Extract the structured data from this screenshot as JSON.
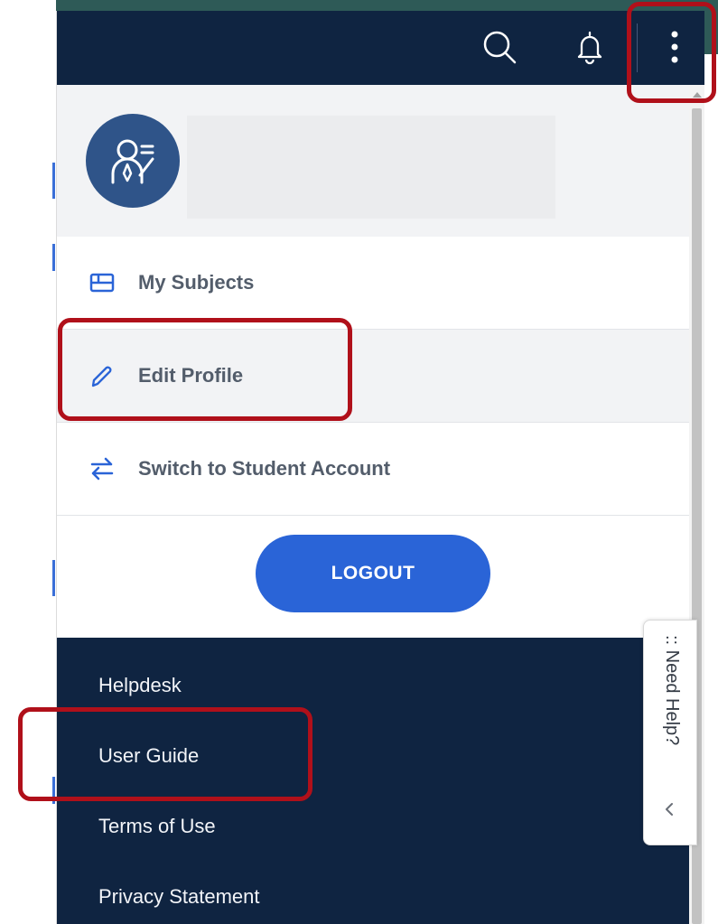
{
  "colors": {
    "topbar": "#0f2441",
    "accent": "#2a64d7",
    "avatar_bg": "#2f5489",
    "menu_text": "#535d6b",
    "highlight": "#b0101a"
  },
  "topbar": {
    "icons": [
      "search-icon",
      "bell-icon",
      "more-vertical-icon"
    ]
  },
  "profile": {
    "avatar_icon": "teacher-avatar-icon",
    "name": ""
  },
  "menu": {
    "items": [
      {
        "label": "My Subjects",
        "icon": "subjects-icon"
      },
      {
        "label": "Edit Profile",
        "icon": "pencil-icon"
      },
      {
        "label": "Switch to Student Account",
        "icon": "switch-arrows-icon"
      }
    ],
    "logout_label": "LOGOUT"
  },
  "footer": {
    "links": [
      "Helpdesk",
      "User Guide",
      "Terms of Use",
      "Privacy Statement"
    ]
  },
  "need_help": {
    "label": ":: Need Help?"
  }
}
